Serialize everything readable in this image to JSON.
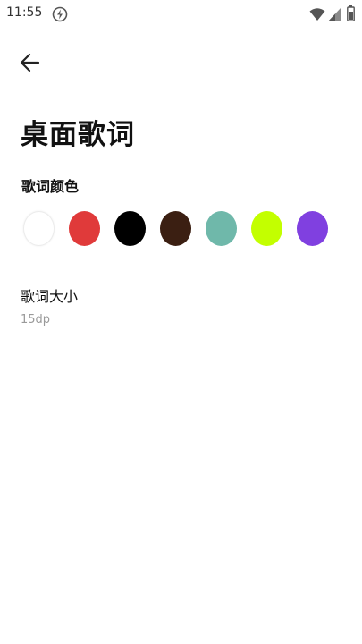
{
  "status_bar": {
    "time": "11:55",
    "icons": [
      "sync-icon",
      "wifi-icon",
      "signal-icon",
      "battery-icon"
    ]
  },
  "header": {
    "back_icon": "arrow-left-icon",
    "title": "桌面歌词"
  },
  "lyrics_color": {
    "label": "歌词颜色",
    "colors": [
      {
        "name": "white",
        "hex": "#ffffff"
      },
      {
        "name": "red",
        "hex": "#e03a3a"
      },
      {
        "name": "black",
        "hex": "#000000"
      },
      {
        "name": "dark-brown",
        "hex": "#3b1f12"
      },
      {
        "name": "teal",
        "hex": "#6fb8aa"
      },
      {
        "name": "lime",
        "hex": "#c3ff00"
      },
      {
        "name": "purple",
        "hex": "#8040e0"
      }
    ]
  },
  "lyrics_size": {
    "label": "歌词大小",
    "value": "15dp"
  }
}
